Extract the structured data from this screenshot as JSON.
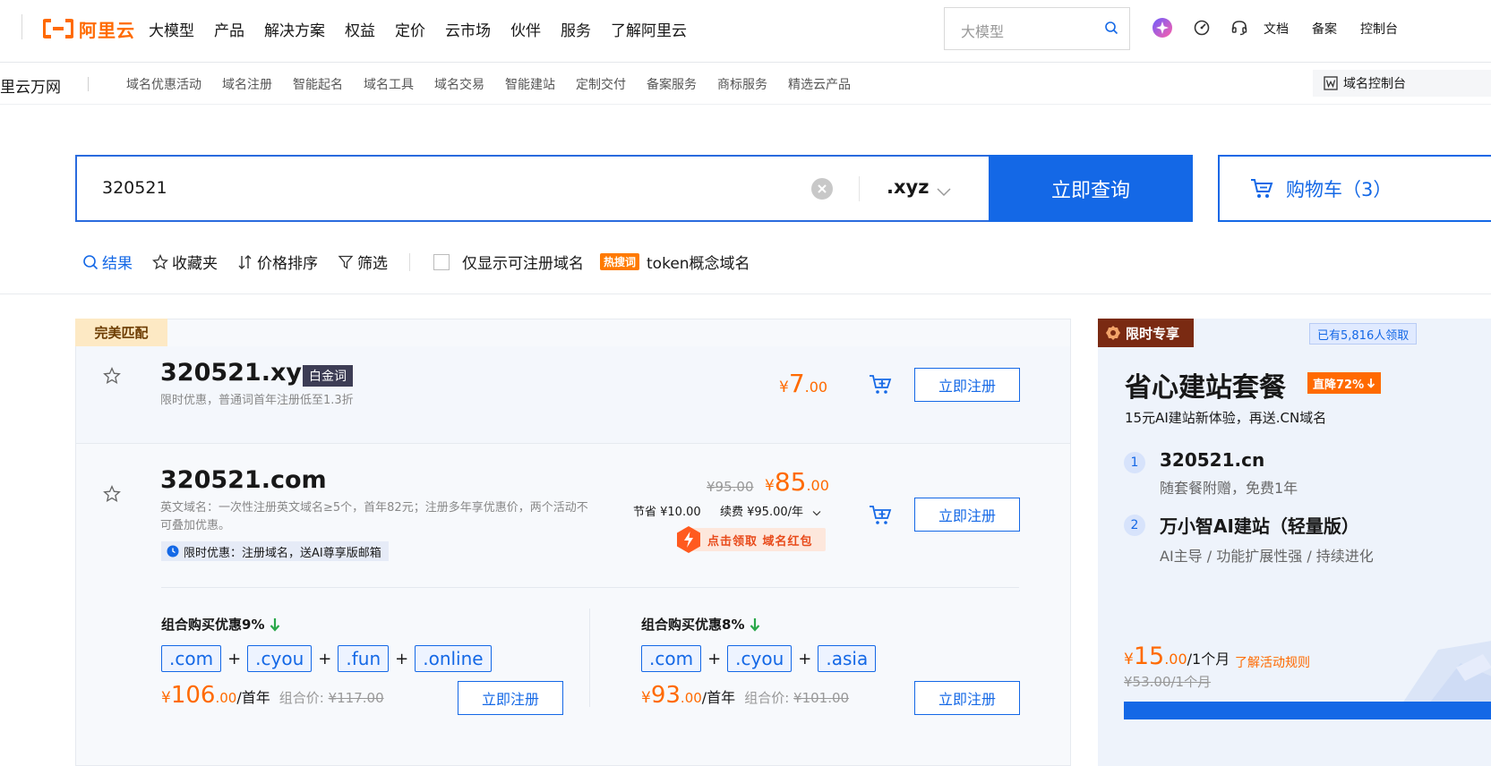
{
  "topnav": {
    "logo_text": "阿里云",
    "items": [
      "大模型",
      "产品",
      "解决方案",
      "权益",
      "定价",
      "云市场",
      "伙伴",
      "服务",
      "了解阿里云"
    ],
    "search_placeholder": "大模型",
    "right_links": [
      "文档",
      "备案",
      "控制台"
    ]
  },
  "subnav": {
    "brand": "里云万网",
    "links": [
      "域名优惠活动",
      "域名注册",
      "智能起名",
      "域名工具",
      "域名交易",
      "智能建站",
      "定制交付",
      "备案服务",
      "商标服务",
      "精选云产品"
    ],
    "console": "域名控制台"
  },
  "search": {
    "value": "320521",
    "tld": ".xyz",
    "button": "立即查询",
    "cart": "购物车（3）"
  },
  "filters": {
    "result": "结果",
    "favorites": "收藏夹",
    "sort": "价格排序",
    "filter": "筛选",
    "only_available": "仅显示可注册域名",
    "hot_tag": "热搜词",
    "hot_word": "token概念域名"
  },
  "results": {
    "perfect_tag": "完美匹配",
    "r1": {
      "domain": "320521.xyz",
      "badge": "白金词",
      "desc": "限时优惠，普通词首年注册低至1.3折",
      "currency": "¥",
      "price_int": "7",
      "price_dec": ".00",
      "register": "立即注册"
    },
    "r2": {
      "domain": "320521.com",
      "desc": "英文域名：一次性注册英文域名≥5个，首年82元；注册多年享优惠价，两个活动不可叠加优惠。",
      "promo": "限时优惠：注册域名，送AI尊享版邮箱",
      "old_price": "¥95.00",
      "currency": "¥",
      "price_int": "85",
      "price_dec": ".00",
      "save": "节省 ¥10.00",
      "renew": "续费 ¥95.00/年",
      "coupon": "点击领取 域名红包",
      "register": "立即注册"
    },
    "combo1": {
      "title": "组合购买优惠9%",
      "tlds": [
        ".com",
        ".cyou",
        ".fun",
        ".online"
      ],
      "currency": "¥",
      "price_int": "106",
      "price_dec": ".00",
      "unit": "/首年",
      "group_label": "组合价:",
      "group_price": "¥117.00",
      "register": "立即注册"
    },
    "combo2": {
      "title": "组合购买优惠8%",
      "tlds": [
        ".com",
        ".cyou",
        ".asia"
      ],
      "currency": "¥",
      "price_int": "93",
      "price_dec": ".00",
      "unit": "/首年",
      "group_label": "组合价:",
      "group_price": "¥101.00",
      "register": "立即注册"
    }
  },
  "side": {
    "limited": "限时专享",
    "people": "已有5,816人领取",
    "title": "省心建站套餐",
    "discount": "直降72%",
    "subtitle": "15元AI建站新体验，再送.CN域名",
    "items": [
      {
        "num": "1",
        "title": "320521.cn",
        "desc": "随套餐附赠，免费1年"
      },
      {
        "num": "2",
        "title": "万小智AI建站（轻量版）",
        "desc": "AI主导 / 功能扩展性强 / 持续进化"
      }
    ],
    "currency": "¥",
    "price_int": "15",
    "price_dec": ".00",
    "unit": "/1个月",
    "rules": "了解活动规则",
    "old_price": "¥53.00/1个月"
  },
  "colors": {
    "brand_orange": "#ff6a00",
    "primary_blue": "#1468e6",
    "price_orange": "#ff6a00"
  }
}
